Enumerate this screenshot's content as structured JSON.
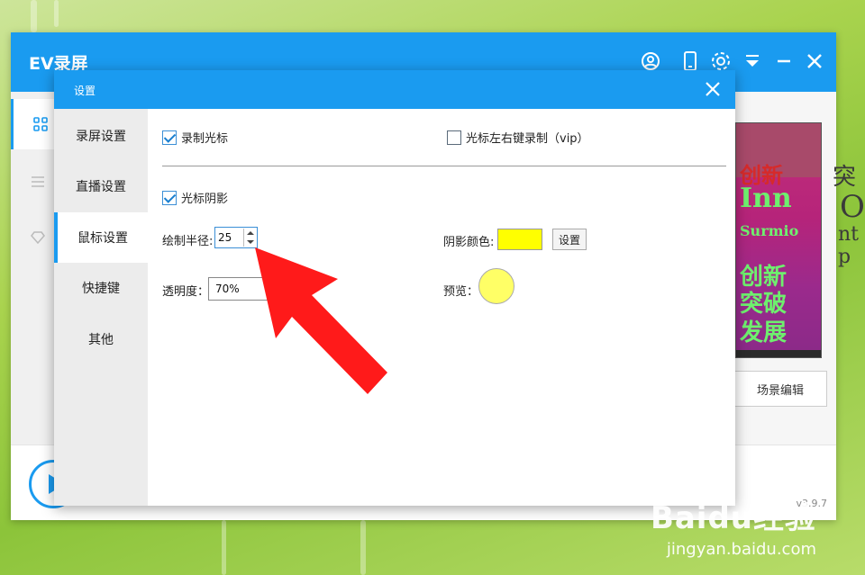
{
  "app": {
    "title": "EV录屏",
    "version": "v3.9.7",
    "scene_edit_label": "场景编辑"
  },
  "preview": {
    "lines": [
      "创新",
      "Inn",
      "Surmio",
      "创新",
      "突破",
      "发展"
    ]
  },
  "background_text": [
    "突",
    "O",
    "nt p"
  ],
  "dialog": {
    "title": "设置",
    "nav": [
      {
        "label": "录屏设置",
        "active": false
      },
      {
        "label": "直播设置",
        "active": false
      },
      {
        "label": "鼠标设置",
        "active": true
      },
      {
        "label": "快捷键",
        "active": false
      },
      {
        "label": "其他",
        "active": false
      }
    ],
    "record_cursor_label": "录制光标",
    "record_cursor_checked": true,
    "cursor_click_label": "光标左右键录制（vip）",
    "cursor_click_checked": false,
    "cursor_shadow_label": "光标阴影",
    "cursor_shadow_checked": true,
    "radius_label": "绘制半径:",
    "radius_value": "25",
    "shadow_color_label": "阴影颜色:",
    "shadow_color": "#ffff00",
    "set_button_label": "设置",
    "opacity_label": "透明度：",
    "opacity_value": "70%",
    "preview_label": "预览：",
    "preview_color": "#ffff66"
  },
  "watermark": {
    "logo": "Baidu经验",
    "url": "jingyan.baidu.com"
  },
  "colors": {
    "accent": "#1a9bf0",
    "arrow": "#ff1a1a"
  }
}
